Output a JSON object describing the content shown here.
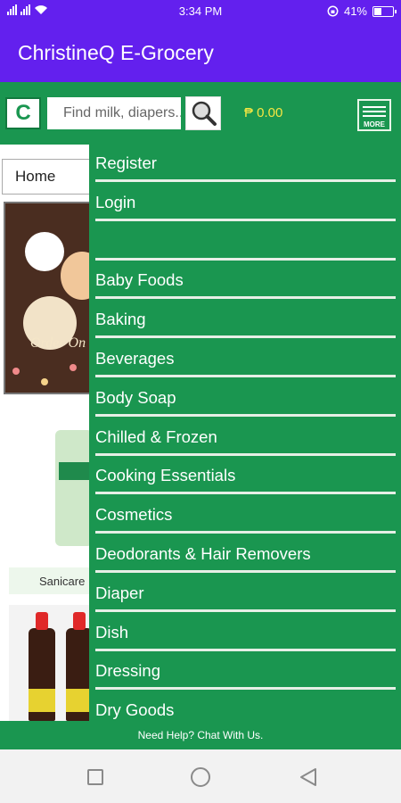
{
  "status_bar": {
    "time": "3:34 PM",
    "battery_percent": "41%",
    "battery_level": 0.41
  },
  "app": {
    "title": "ChristineQ E-Grocery"
  },
  "toolbar": {
    "logo_letter": "C",
    "search_placeholder": "Find milk, diapers...",
    "cart_total": "₱ 0.00",
    "more_label": "MORE"
  },
  "content": {
    "category_select": "Home",
    "banner_text": "Order On",
    "product_caption": "Sanicare"
  },
  "drawer": {
    "items": [
      "Register",
      "Login",
      "",
      "Baby Foods",
      "Baking",
      "Beverages",
      "Body Soap",
      "Chilled & Frozen",
      "Cooking Essentials",
      "Cosmetics",
      "Deodorants & Hair Removers",
      "Diaper",
      "Dish",
      "Dressing",
      "Dry Goods"
    ]
  },
  "footer": {
    "help_text": "Need Help? Chat With Us."
  },
  "colors": {
    "primary": "#6320ee",
    "green": "#1a9650",
    "cart_text": "#f5e642"
  },
  "icons": {
    "search": "magnifier-icon",
    "menu": "hamburger-icon"
  }
}
